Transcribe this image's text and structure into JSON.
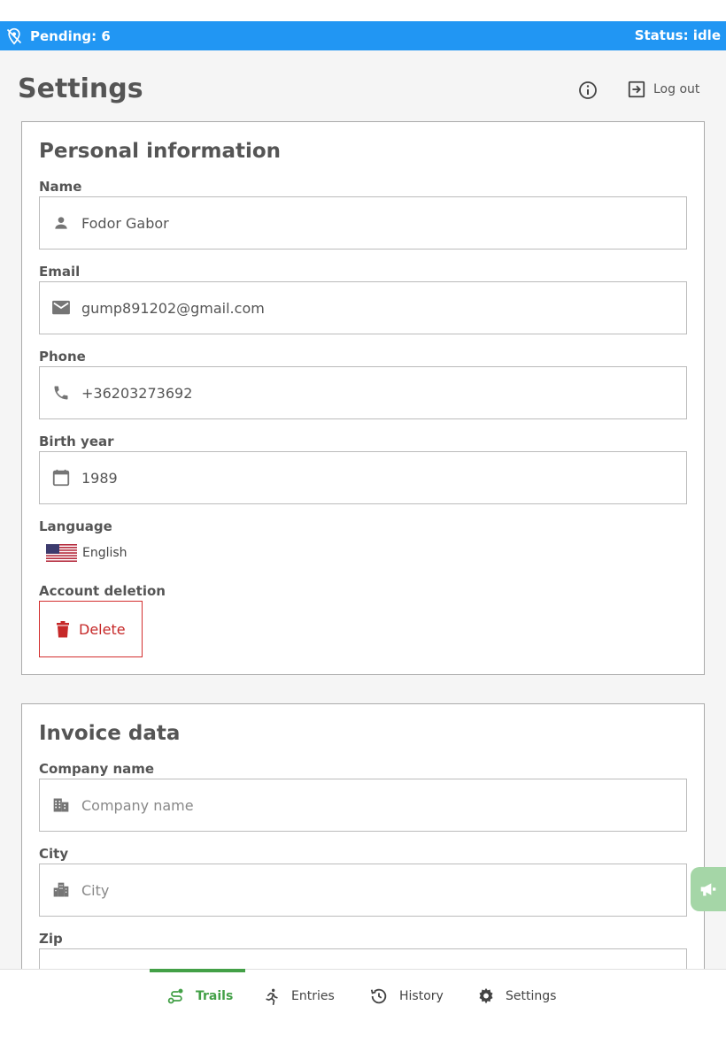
{
  "status_bar": {
    "pending": "Pending: 6",
    "status": "Status: idle"
  },
  "header": {
    "title": "Settings",
    "logout": "Log out"
  },
  "personal": {
    "title": "Personal information",
    "name_label": "Name",
    "name_value": "Fodor Gabor",
    "email_label": "Email",
    "email_value": "gump891202@gmail.com",
    "phone_label": "Phone",
    "phone_value": "+36203273692",
    "birth_label": "Birth year",
    "birth_value": "1989",
    "language_label": "Language",
    "language_value": "English",
    "deletion_label": "Account deletion",
    "delete_button": "Delete"
  },
  "invoice": {
    "title": "Invoice data",
    "company_label": "Company name",
    "company_placeholder": "Company name",
    "city_label": "City",
    "city_placeholder": "City",
    "zip_label": "Zip"
  },
  "nav": {
    "items": [
      {
        "label": "Trails",
        "icon": "trail-icon",
        "active": true
      },
      {
        "label": "Entries",
        "icon": "running-icon",
        "active": false
      },
      {
        "label": "History",
        "icon": "history-icon",
        "active": false
      },
      {
        "label": "Settings",
        "icon": "gear-icon",
        "active": false
      }
    ]
  },
  "colors": {
    "status_bar": "#2196f3",
    "accent": "#43a047",
    "danger": "#c62828"
  }
}
